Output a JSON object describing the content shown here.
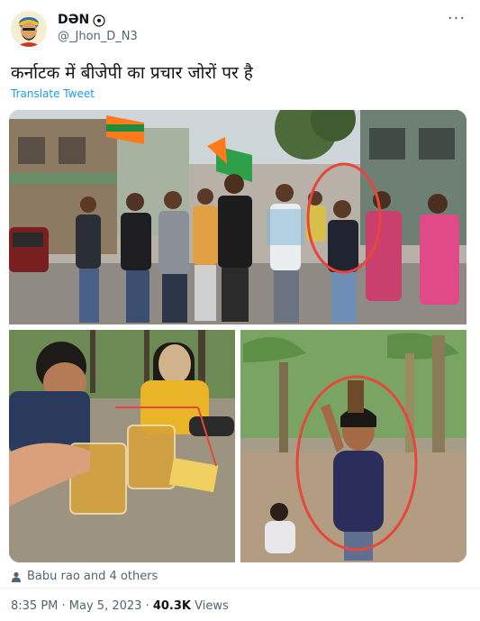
{
  "author": {
    "display_name": "DƏN",
    "handle": "@_Jhon_D_N3",
    "avatar_icon": "avatar-cartoon-icon",
    "name_badge_icon": "soccer-ball-icon"
  },
  "menu": {
    "more_label": "···"
  },
  "tweet": {
    "text": "कर्नाटक में बीजेपी का प्रचार जोरों पर है",
    "translate_label": "Translate Tweet"
  },
  "media": {
    "image_top_icon": "rally-photo",
    "image_bottom_left_icon": "drinks-photo",
    "image_bottom_right_icon": "banana-grove-photo"
  },
  "likers": {
    "text": "Babu rao and 4 others",
    "icon": "person-icon"
  },
  "meta": {
    "time": "8:35 PM",
    "separator": " · ",
    "date": "May 5, 2023",
    "views_count": "40.3K",
    "views_label": " Views"
  },
  "colors": {
    "link": "#1d9bf0",
    "secondary_text": "#536471",
    "primary_text": "#0f1419",
    "circle_annotation": "#e8463a"
  }
}
